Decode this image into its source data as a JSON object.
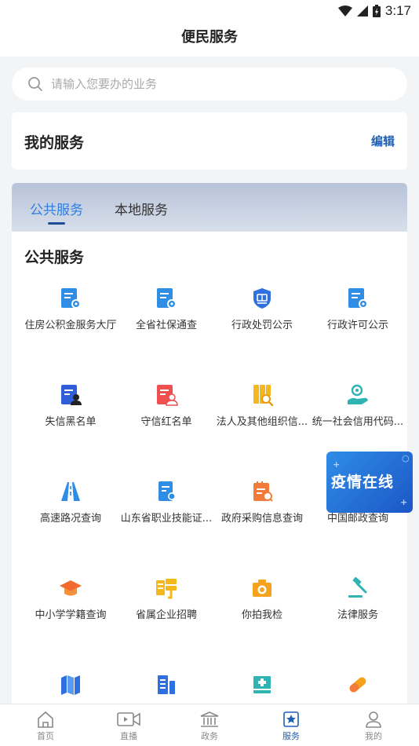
{
  "status": {
    "time": "3:17",
    "icons": [
      "wifi-icon",
      "signal-icon",
      "battery-icon"
    ]
  },
  "header": {
    "title": "便民服务"
  },
  "search": {
    "placeholder": "请输入您要办的业务"
  },
  "my_services": {
    "title": "我的服务",
    "edit_label": "编辑"
  },
  "tabs": [
    {
      "label": "公共服务",
      "active": true
    },
    {
      "label": "本地服务",
      "active": false
    }
  ],
  "public_services": {
    "title": "公共服务",
    "items": [
      {
        "label": "住房公积金服务大厅",
        "icon": "certificate-icon"
      },
      {
        "label": "全省社保通查",
        "icon": "certificate-icon"
      },
      {
        "label": "行政处罚公示",
        "icon": "penalty-shield-icon"
      },
      {
        "label": "行政许可公示",
        "icon": "certificate-icon"
      },
      {
        "label": "失信黑名单",
        "icon": "blacklist-icon"
      },
      {
        "label": "守信红名单",
        "icon": "redlist-icon"
      },
      {
        "label": "法人及其他组织信...",
        "icon": "org-search-icon"
      },
      {
        "label": "统一社会信用代码...",
        "icon": "credit-hand-icon"
      },
      {
        "label": "高速路况查询",
        "icon": "highway-icon"
      },
      {
        "label": "山东省职业技能证...",
        "icon": "skill-certificate-icon"
      },
      {
        "label": "政府采购信息查询",
        "icon": "procurement-icon"
      },
      {
        "label": "中国邮政查询",
        "icon": "post-icon"
      },
      {
        "label": "中小学学籍查询",
        "icon": "graduation-cap-icon"
      },
      {
        "label": "省属企业招聘",
        "icon": "recruit-icon"
      },
      {
        "label": "你拍我检",
        "icon": "camera-icon"
      },
      {
        "label": "法律服务",
        "icon": "gavel-icon"
      },
      {
        "label": "",
        "icon": "map-icon"
      },
      {
        "label": "",
        "icon": "building-icon"
      },
      {
        "label": "",
        "icon": "hospital-icon"
      },
      {
        "label": "",
        "icon": "pill-icon"
      }
    ]
  },
  "epidemic_banner": {
    "text": "疫情在线"
  },
  "bottom_nav": [
    {
      "label": "首页",
      "icon": "home-icon",
      "active": false
    },
    {
      "label": "直播",
      "icon": "video-icon",
      "active": false
    },
    {
      "label": "政务",
      "icon": "government-icon",
      "active": false
    },
    {
      "label": "服务",
      "icon": "service-star-icon",
      "active": true
    },
    {
      "label": "我的",
      "icon": "user-icon",
      "active": false
    }
  ],
  "colors": {
    "accent": "#2f7de1",
    "brand": "#1f5fb3",
    "background": "#f3f4f6"
  }
}
